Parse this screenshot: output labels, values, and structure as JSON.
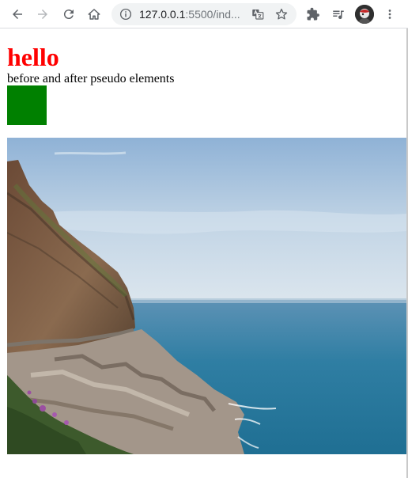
{
  "browser": {
    "url_host": "127.0.0.1",
    "url_path": ":5500/ind...",
    "icons": {
      "back": "arrow-left",
      "forward": "arrow-right",
      "reload": "circular-arrow",
      "home": "house",
      "site_info": "info-circle",
      "translate": "translate",
      "bookmark": "star-outline",
      "extensions": "puzzle-piece",
      "media": "playlist-music",
      "profile": "avatar",
      "menu": "three-dots-vertical"
    }
  },
  "page": {
    "heading": "hello",
    "caption": "before and after pseudo elements",
    "heading_color": "#ff0000",
    "box_color": "#008000",
    "image_subject": "coastal cliff road above blue ocean"
  }
}
